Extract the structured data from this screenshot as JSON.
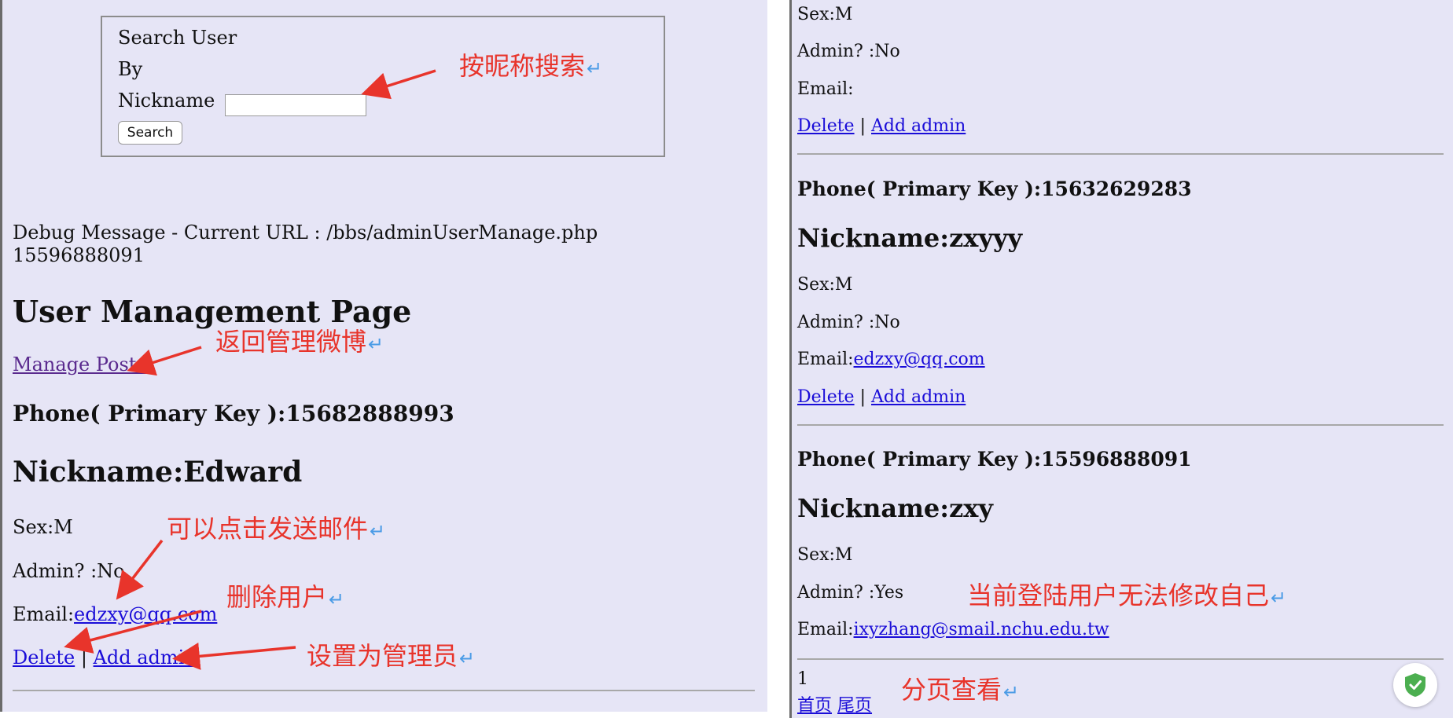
{
  "search": {
    "title_line1": "Search User",
    "title_line2": "By",
    "title_line3": "Nickname",
    "input_value": "",
    "button_label": "Search"
  },
  "debug": {
    "message": "Debug Message - Current URL : /bbs/adminUserManage.php",
    "session_phone": "15596888091"
  },
  "page_title": "User Management Page",
  "manage_posts_link": "Manage Posts",
  "users": [
    {
      "phone_line": "Phone( Primary Key ):15682888993",
      "nickname_line": "Nickname:Edward",
      "sex_line": "Sex:M",
      "admin_line": "Admin? :No",
      "email_label": "Email:",
      "email_value": "edzxy@qq.com",
      "delete_label": "Delete",
      "separator": "|",
      "add_admin_label": "Add admin"
    },
    {
      "sex_line": "Sex:M",
      "admin_line": "Admin? :No",
      "email_label": "Email:",
      "email_value": "",
      "delete_label": "Delete",
      "separator": "|",
      "add_admin_label": "Add admin"
    },
    {
      "phone_line": "Phone( Primary Key ):15632629283",
      "nickname_line": "Nickname:zxyyy",
      "sex_line": "Sex:M",
      "admin_line": "Admin? :No",
      "email_label": "Email:",
      "email_value": "edzxy@qq.com",
      "delete_label": "Delete",
      "separator": "|",
      "add_admin_label": "Add admin"
    },
    {
      "phone_line": "Phone( Primary Key ):15596888091",
      "nickname_line": "Nickname:zxy",
      "sex_line": "Sex:M",
      "admin_line": "Admin? :Yes",
      "email_label": "Email:",
      "email_value": "ixyzhang@smail.nchu.edu.tw"
    }
  ],
  "pagination": {
    "current_page": "1",
    "first_page_label": "首页",
    "last_page_label": "尾页"
  },
  "annotations": {
    "search_by_nickname": "按昵称搜索",
    "back_to_manage_posts": "返回管理微博",
    "click_to_send_email": "可以点击发送邮件",
    "delete_user": "删除用户",
    "set_as_admin": "设置为管理员",
    "cannot_modify_self": "当前登陆用户无法修改自己",
    "paged_view": "分页查看",
    "return_mark": "↵"
  },
  "colors": {
    "page_background": "#e6e5f6",
    "link": "#1a0dd8",
    "visited_link": "#5a2a8e",
    "annotation_red": "#e8342b",
    "return_mark_blue": "#4a9be6",
    "shield_green": "#4caf50"
  },
  "icons": {
    "security_badge": "shield-check-icon"
  }
}
